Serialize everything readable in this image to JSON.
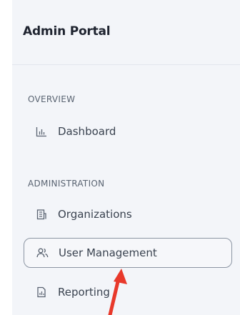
{
  "app": {
    "title": "Admin Portal"
  },
  "sections": [
    {
      "label": "OVERVIEW",
      "items": [
        {
          "label": "Dashboard",
          "icon": "bar-chart-icon"
        }
      ]
    },
    {
      "label": "ADMINISTRATION",
      "items": [
        {
          "label": "Organizations",
          "icon": "building-icon"
        },
        {
          "label": "User Management",
          "icon": "users-icon",
          "active": true
        },
        {
          "label": "Reporting",
          "icon": "report-icon"
        }
      ]
    }
  ],
  "colors": {
    "sidebar_bg": "#f3f5f9",
    "active_border": "#8c95a3",
    "annotation_arrow": "#e8392b"
  }
}
